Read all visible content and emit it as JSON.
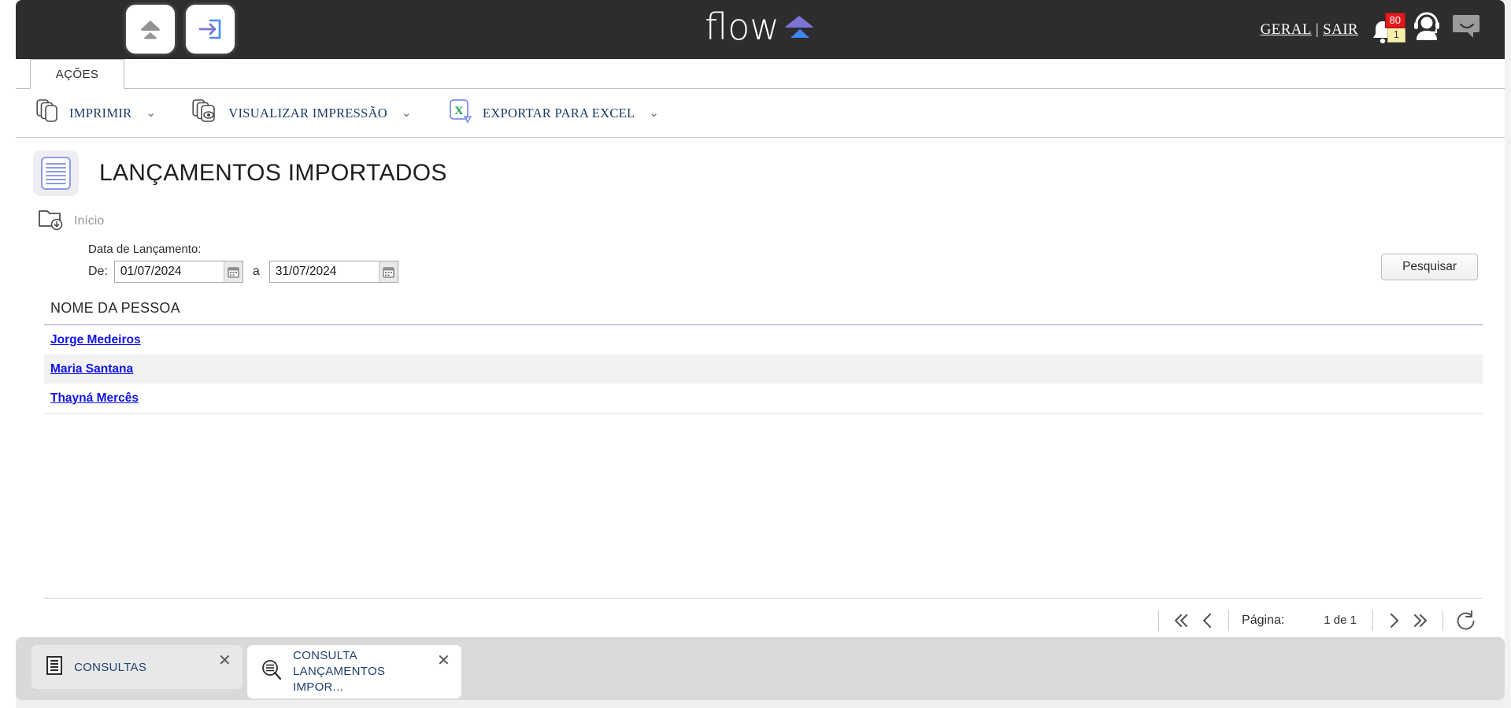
{
  "header": {
    "logo_text": "flow",
    "left_icons": [
      {
        "name": "upload-cloud-icon"
      },
      {
        "name": "login-arrow-icon"
      }
    ],
    "links": {
      "geral": "GERAL",
      "separator": "|",
      "sair": "SAIR"
    },
    "notifications": {
      "bell_icon": "bell-icon",
      "badge_primary": "80",
      "badge_secondary": "1"
    },
    "support_icon": "headset-user-icon",
    "chat_icon": "chat-bubble-icon"
  },
  "tabs": {
    "acoes": "AÇÕES"
  },
  "ribbon": {
    "buttons": [
      {
        "label": "IMPRIMIR",
        "icon": "print-copies-icon",
        "has_dropdown": true
      },
      {
        "label": "VISUALIZAR IMPRESSÃO",
        "icon": "print-preview-icon",
        "has_dropdown": true
      },
      {
        "label": "EXPORTAR PARA EXCEL",
        "icon": "excel-icon",
        "has_dropdown": true
      }
    ],
    "chevron": "⌄"
  },
  "page": {
    "icon": "document-lines-icon",
    "title": "LANÇAMENTOS IMPORTADOS",
    "breadcrumb": {
      "icon": "folder-download-icon",
      "label": "Início"
    }
  },
  "filters": {
    "group_label": "Data de Lançamento:",
    "from_label": "De:",
    "from_value": "01/07/2024",
    "from_placeholder": "dd/mm/aaaa",
    "between_label": "a",
    "to_value": "31/07/2024",
    "to_placeholder": "dd/mm/aaaa",
    "calendar_icon": "calendar-icon",
    "search_button": "Pesquisar"
  },
  "grid": {
    "columns": [
      "NOME DA PESSOA"
    ],
    "rows": [
      {
        "name": "Jorge Medeiros"
      },
      {
        "name": "Maria Santana"
      },
      {
        "name": "Thayná Mercês"
      }
    ]
  },
  "pager": {
    "first_icon": "chevron-double-left-icon",
    "prev_icon": "chevron-left-icon",
    "page_label": "Página:",
    "page_value": "1 de 1",
    "next_icon": "chevron-right-icon",
    "last_icon": "chevron-double-right-icon",
    "refresh_icon": "refresh-icon"
  },
  "taskbar": {
    "items": [
      {
        "label": "CONSULTAS",
        "label_line1": "CONSULTAS",
        "label_line2": "",
        "icon": "list-document-icon",
        "active": false,
        "close": "✕"
      },
      {
        "label": "CONSULTA LANÇAMENTOS IMPOR...",
        "label_line1": "CONSULTA",
        "label_line2": "LANÇAMENTOS IMPOR...",
        "icon": "search-list-icon",
        "active": true,
        "close": "✕"
      }
    ]
  },
  "colors": {
    "header_bg": "#2d2d2d",
    "link_blue": "#0f12e8",
    "ribbon_text": "#1b3a66",
    "accent_purple": "#7b74d4",
    "accent_blue": "#3d87f5",
    "badge_red": "#e01b1b",
    "badge_yellow": "#f7f0ad"
  }
}
